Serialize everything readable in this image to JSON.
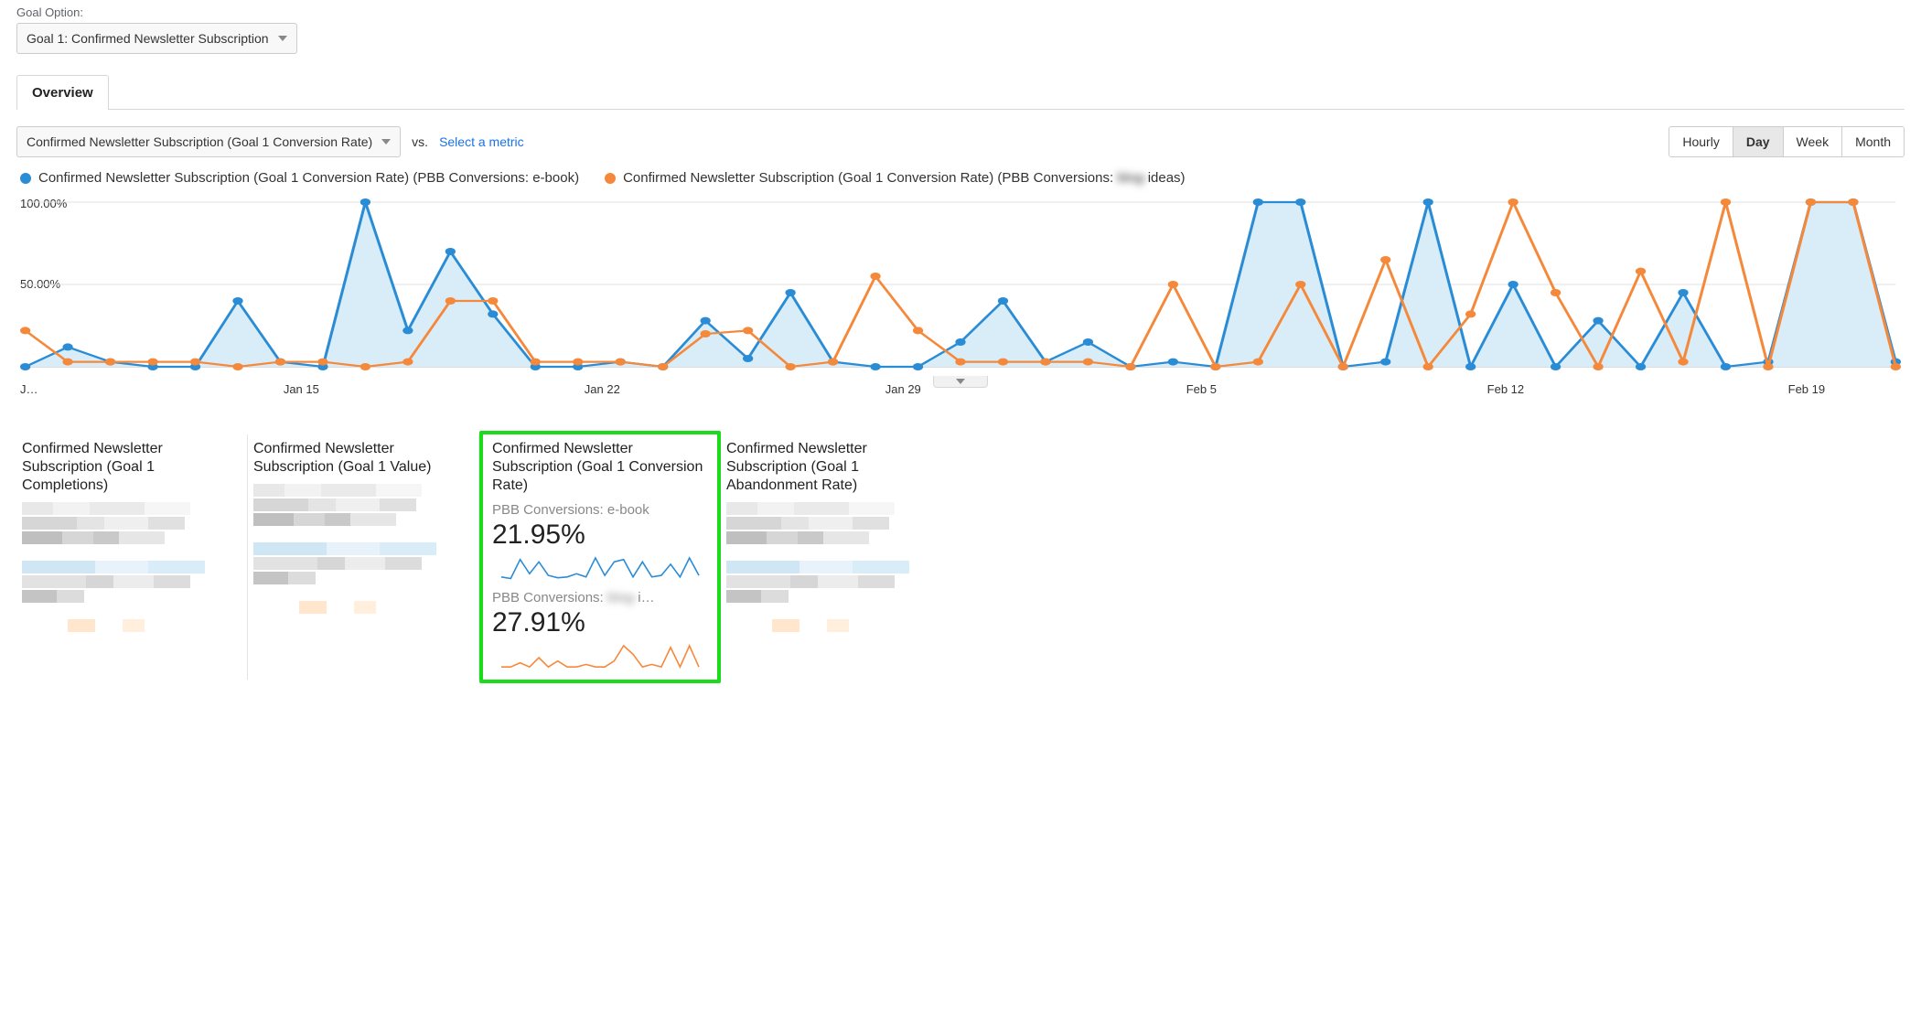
{
  "goal_option": {
    "label": "Goal Option:",
    "selected": "Goal 1: Confirmed Newsletter Subscription"
  },
  "tab": "Overview",
  "metric_selector": {
    "primary": "Confirmed Newsletter Subscription (Goal 1 Conversion Rate)",
    "vs": "vs.",
    "select_metric": "Select a metric"
  },
  "granularity": {
    "options": [
      "Hourly",
      "Day",
      "Week",
      "Month"
    ],
    "active": "Day"
  },
  "legend": {
    "a": "Confirmed Newsletter Subscription (Goal 1 Conversion Rate) (PBB Conversions: e-book)",
    "b_prefix": "Confirmed Newsletter Subscription (Goal 1 Conversion Rate) (PBB Conversions: ",
    "b_blur": "blog-",
    "b_suffix": "ideas)"
  },
  "colors": {
    "blue": "#2b8cd6",
    "orange": "#f5893b",
    "light_blue_fill": "#d9edf8"
  },
  "cards": [
    {
      "title": "Confirmed Newsletter Subscription (Goal 1 Completions)"
    },
    {
      "title": "Confirmed Newsletter Subscription (Goal 1 Value)"
    },
    {
      "title": "Confirmed Newsletter Subscription (Goal 1 Conversion Rate)",
      "highlight": true,
      "rows": [
        {
          "label": "PBB Conversions: e-book",
          "value": "21.95%",
          "color": "#2b8cd6"
        },
        {
          "label_prefix": "PBB Conversions: ",
          "label_blur": "blog-",
          "label_suffix": "i…",
          "value": "27.91%",
          "color": "#f5893b"
        }
      ]
    },
    {
      "title": "Confirmed Newsletter Subscription (Goal 1 Abandonment Rate)"
    }
  ],
  "chart_data": {
    "type": "line",
    "ylabel": "",
    "ylim": [
      0,
      100
    ],
    "y_ticks": [
      "50.00%",
      "100.00%"
    ],
    "x_ticks": [
      "J…",
      "Jan 15",
      "Jan 22",
      "Jan 29",
      "Feb 5",
      "Feb 12",
      "Feb 19"
    ],
    "x_tick_positions_pct": [
      0,
      14,
      30,
      46,
      62,
      78,
      94
    ],
    "n_points": 45,
    "series": [
      {
        "name": "PBB Conversions: e-book",
        "color": "#2b8cd6",
        "values": [
          0,
          12,
          3,
          0,
          0,
          40,
          3,
          0,
          100,
          22,
          70,
          32,
          0,
          0,
          3,
          0,
          28,
          5,
          45,
          3,
          0,
          0,
          15,
          40,
          3,
          15,
          0,
          3,
          0,
          100,
          100,
          0,
          3,
          100,
          0,
          50,
          0,
          28,
          0,
          45,
          0,
          3,
          100,
          100,
          3
        ]
      },
      {
        "name": "PBB Conversions: ideas",
        "color": "#f5893b",
        "values": [
          22,
          3,
          3,
          3,
          3,
          0,
          3,
          3,
          0,
          3,
          40,
          40,
          3,
          3,
          3,
          0,
          20,
          22,
          0,
          3,
          55,
          22,
          3,
          3,
          3,
          3,
          0,
          50,
          0,
          3,
          50,
          0,
          65,
          0,
          32,
          100,
          45,
          0,
          58,
          3,
          100,
          0,
          100,
          100,
          0
        ]
      }
    ],
    "sparklines": {
      "a": [
        6,
        4,
        28,
        10,
        25,
        8,
        5,
        6,
        10,
        6,
        30,
        8,
        25,
        28,
        6,
        25,
        6,
        8,
        22,
        6,
        30,
        8
      ],
      "b": [
        3,
        3,
        8,
        3,
        14,
        3,
        10,
        3,
        3,
        6,
        3,
        3,
        10,
        28,
        18,
        3,
        6,
        3,
        26,
        3,
        28,
        3
      ]
    }
  }
}
